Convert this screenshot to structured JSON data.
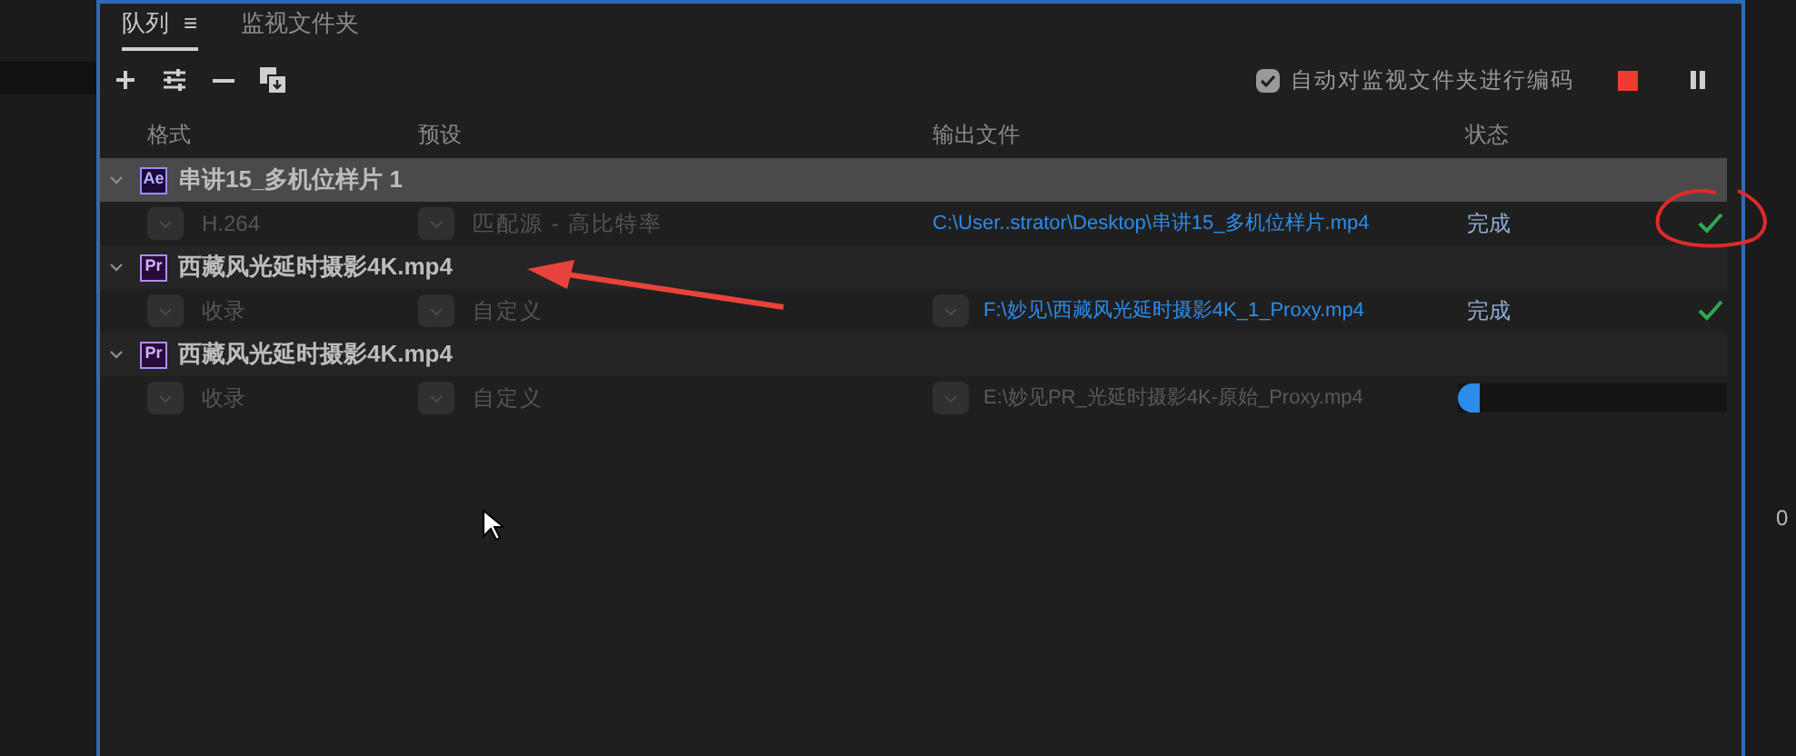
{
  "panel_tabs": [
    {
      "label": "队列",
      "selected": true,
      "menu": "≡"
    },
    {
      "label": "监视文件夹",
      "selected": false
    }
  ],
  "toolbar": {
    "auto_encode": {
      "label": "自动对监视文件夹进行编码",
      "checked": true
    }
  },
  "columns": [
    "格式",
    "预设",
    "输出文件",
    "状态"
  ],
  "groups": [
    {
      "app": "Ae",
      "name": "串讲15_多机位样片 1",
      "expanded": true,
      "selected": true,
      "items": [
        {
          "format": "H.264",
          "preset": "匹配源 - 高比特率",
          "output": "C:\\User..strator\\Desktop\\串讲15_多机位样片.mp4",
          "output_menu": false,
          "kind": "done",
          "status": "完成"
        }
      ]
    },
    {
      "app": "Pr",
      "name": "西藏风光延时摄影4K.mp4",
      "expanded": true,
      "selected": false,
      "items": [
        {
          "format": "收录",
          "preset": "自定义",
          "output": "F:\\妙见\\西藏风光延时摄影4K_1_Proxy.mp4",
          "output_menu": true,
          "kind": "done",
          "status": "完成"
        }
      ]
    },
    {
      "app": "Pr",
      "name": "西藏风光延时摄影4K.mp4",
      "expanded": true,
      "selected": false,
      "items": [
        {
          "format": "收录",
          "preset": "自定义",
          "output": "E:\\妙见PR_光延时摄影4K-原始_Proxy.mp4",
          "output_menu": true,
          "kind": "encoding",
          "level": 0.08
        }
      ]
    }
  ],
  "side_panel": {
    "reading": "0"
  }
}
